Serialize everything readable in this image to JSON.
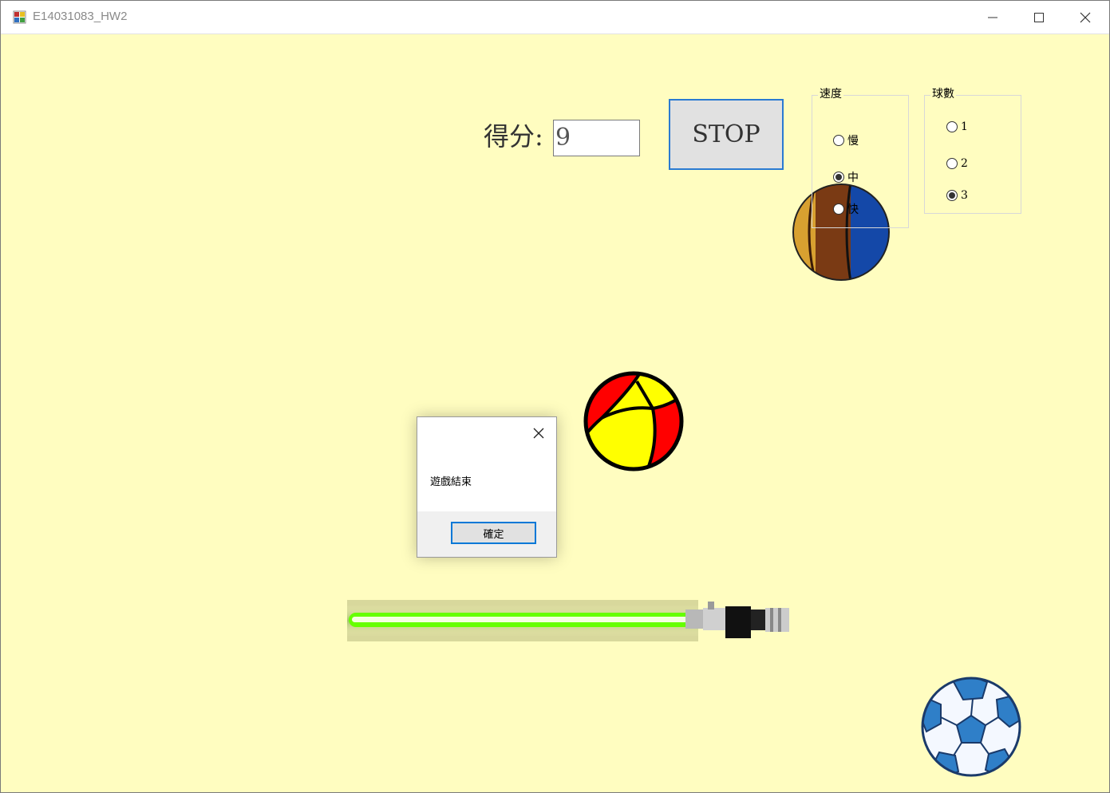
{
  "window": {
    "title": "E14031083_HW2"
  },
  "score": {
    "label": "得分:",
    "value": "9"
  },
  "stop_button": {
    "label": "STOP"
  },
  "speed_group": {
    "title": "速度",
    "options": [
      "慢",
      "中",
      "快"
    ],
    "selected": "中"
  },
  "ball_count_group": {
    "title": "球數",
    "options": [
      "1",
      "2",
      "3"
    ],
    "selected": "3"
  },
  "message_box": {
    "text": "遊戲結束",
    "ok_label": "確定"
  },
  "colors": {
    "background": "#fffdc0",
    "accent": "#0078d7",
    "beach_ball_red": "#ff0000",
    "beach_ball_yellow": "#ffff00",
    "saber_green": "#66ff00"
  },
  "icons": [
    "app-icon",
    "minimize-icon",
    "maximize-icon",
    "close-icon",
    "basketball-ball",
    "beach-ball",
    "soccer-ball",
    "lightsaber-paddle"
  ]
}
